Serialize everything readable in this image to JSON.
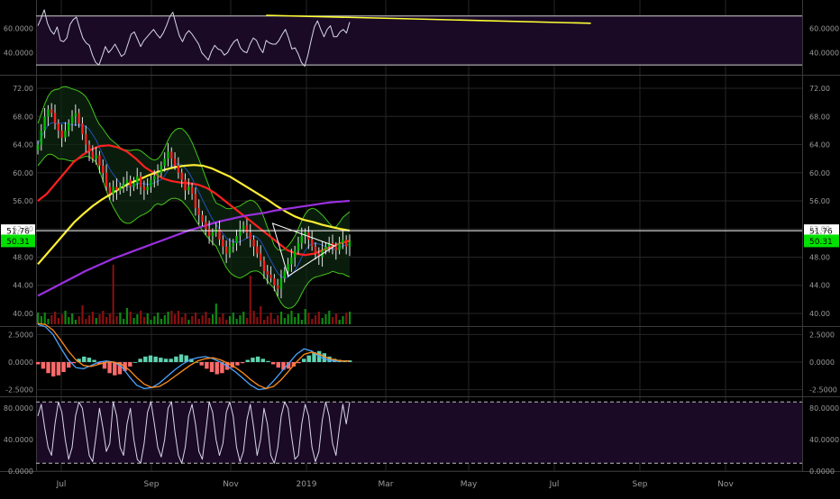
{
  "chart_data": [
    {
      "type": "line",
      "panel": "rsi",
      "y_ticks": [
        "60.0000",
        "40.0000"
      ],
      "ylim": [
        22,
        83
      ],
      "levels": [
        70,
        30
      ],
      "background": "#1a0a26",
      "series": [
        {
          "color": "#d8d8e8",
          "values": [
            62,
            68,
            75,
            64,
            58,
            55,
            61,
            50,
            49,
            52,
            63,
            67,
            69,
            60,
            52,
            48,
            46,
            38,
            32,
            30,
            37,
            45,
            40,
            43,
            47,
            42,
            37,
            39,
            47,
            55,
            57,
            51,
            45,
            50,
            53,
            56,
            59,
            55,
            52,
            56,
            62,
            69,
            73,
            63,
            54,
            49,
            55,
            58,
            55,
            51,
            47,
            40,
            37,
            34,
            41,
            46,
            43,
            42,
            38,
            40,
            45,
            49,
            51,
            44,
            41,
            40,
            47,
            52,
            50,
            44,
            40,
            50,
            48,
            47,
            47,
            50,
            55,
            59,
            52,
            43,
            44,
            39,
            32,
            29,
            38,
            50,
            61,
            66,
            59,
            53,
            59,
            62,
            53,
            53,
            57,
            59,
            56,
            65
          ]
        }
      ],
      "trendline": {
        "color": "#ffff33",
        "from": [
          71,
          70.5
        ],
        "to": [
          172,
          64
        ]
      }
    },
    {
      "type": "candlestick",
      "panel": "price",
      "y_ticks": [
        "72.00",
        "68.00",
        "64.00",
        "60.00",
        "56.00",
        "52.00",
        "48.00",
        "44.00",
        "40.00"
      ],
      "ylim": [
        38.2,
        73.8
      ],
      "price_labels": [
        {
          "text": "51.76",
          "value": 51.76,
          "bg": "#ffffff",
          "fg": "#000000"
        },
        {
          "text": "50.31",
          "value": 50.31,
          "bg": "#00e000",
          "fg": "#000000"
        }
      ],
      "close": [
        64,
        66,
        68,
        69,
        68.5,
        67,
        66,
        65,
        66,
        67,
        68,
        68.5,
        67,
        65.5,
        64,
        63,
        62,
        62.5,
        61,
        60,
        58,
        57,
        58,
        57.5,
        58,
        58.5,
        59,
        58,
        58.5,
        59.5,
        58,
        57.5,
        58,
        59,
        59.5,
        60,
        61,
        62,
        63,
        62,
        61,
        60,
        59,
        57.5,
        58,
        57,
        55,
        54,
        53,
        52,
        51,
        51.5,
        52,
        50.5,
        49.5,
        48.5,
        49.5,
        50,
        51,
        52,
        52.5,
        51.5,
        50.5,
        49.5,
        48.5,
        47.5,
        46,
        45.5,
        45,
        44,
        43.5,
        45,
        46,
        47,
        48,
        49,
        50,
        51,
        51.5,
        50.5,
        49.5,
        48.5,
        48,
        49,
        49.5,
        50,
        49.5,
        49,
        50,
        50.5,
        49.5,
        50.31
      ],
      "series": [
        {
          "name": "",
          "color": "#ff2020",
          "values": [
            56,
            57,
            58.5,
            60,
            61.5,
            62.5,
            63.3,
            63.8,
            63.9,
            63.6,
            63,
            62,
            60.8,
            60,
            59.2,
            58.8,
            58.6,
            58.5,
            58.3,
            57.8,
            57,
            56,
            55,
            54,
            53,
            52,
            51,
            50,
            49,
            48.5,
            48.3,
            48.5,
            49,
            49.5,
            50,
            50.31
          ]
        },
        {
          "name": "",
          "color": "#ffee33",
          "values": [
            47,
            48.5,
            50,
            51.5,
            53,
            54.2,
            55.3,
            56.2,
            57,
            57.8,
            58.5,
            59,
            59.6,
            60.1,
            60.5,
            60.8,
            61,
            61.1,
            61,
            60.6,
            60,
            59.4,
            58.6,
            57.8,
            57,
            56.2,
            55.3,
            54.5,
            53.8,
            53.3,
            53,
            52.6,
            52.3,
            52,
            51.76
          ]
        },
        {
          "name": "",
          "color": "#9b30e0",
          "values": [
            42.5,
            43.2,
            43.9,
            44.6,
            45.3,
            46,
            46.6,
            47.2,
            47.8,
            48.3,
            48.8,
            49.3,
            49.8,
            50.3,
            50.8,
            51.3,
            51.8,
            52.2,
            52.6,
            53,
            53.3,
            53.6,
            53.9,
            54.1,
            54.3,
            54.6,
            54.8,
            55,
            55.2,
            55.4,
            55.6,
            55.8,
            55.9,
            56
          ]
        }
      ],
      "triangle": {
        "color": "#ffffff",
        "points": [
          [
            136,
            52.8
          ],
          [
            172,
            49.6
          ],
          [
            145,
            45.3
          ]
        ]
      }
    },
    {
      "type": "bar",
      "panel": "macd",
      "y_ticks": [
        "2.5000",
        "0.0000",
        "-2.5000"
      ],
      "ylim": [
        -3.1,
        3.1
      ],
      "histogram": [
        -0.2,
        -0.6,
        -1,
        -1.3,
        -1.2,
        -0.9,
        -0.5,
        -0.1,
        0.3,
        0.5,
        0.4,
        0.2,
        -0.2,
        -0.6,
        -1,
        -1.2,
        -1.1,
        -0.8,
        -0.4,
        0,
        0.3,
        0.5,
        0.6,
        0.5,
        0.4,
        0.3,
        0.3,
        0.5,
        0.7,
        0.6,
        0.3,
        0,
        -0.3,
        -0.6,
        -0.9,
        -1.1,
        -1,
        -0.7,
        -0.5,
        -0.3,
        -0.1,
        0.2,
        0.4,
        0.5,
        0.3,
        0.1,
        -0.2,
        -0.5,
        -0.7,
        -0.6,
        -0.4,
        -0.1,
        0.3,
        0.6,
        0.9,
        1,
        0.8,
        0.5,
        0.3,
        0.2,
        0.1,
        0.15
      ],
      "series": [
        {
          "name": "",
          "color": "#4aa3ff",
          "values": [
            3.4,
            3.2,
            2.5,
            1.3,
            0.2,
            -0.5,
            -0.6,
            -0.3,
            0,
            0.1,
            0,
            -0.4,
            -1.3,
            -2.1,
            -2.4,
            -2.3,
            -1.9,
            -1.3,
            -0.7,
            -0.2,
            0.2,
            0.4,
            0.5,
            0.3,
            0,
            -0.4,
            -0.9,
            -1.5,
            -2.1,
            -2.5,
            -2.4,
            -1.7,
            -0.9,
            -0.1,
            0.7,
            1.2,
            1,
            0.5,
            0.2,
            0.1,
            0.1,
            0.1
          ]
        },
        {
          "name": "",
          "color": "#ff8c1a",
          "values": [
            3.5,
            3.4,
            2.9,
            2,
            1,
            0.2,
            -0.3,
            -0.4,
            -0.2,
            0,
            0,
            -0.2,
            -0.7,
            -1.4,
            -2,
            -2.3,
            -2.2,
            -1.8,
            -1.3,
            -0.8,
            -0.3,
            0.1,
            0.3,
            0.4,
            0.2,
            -0.1,
            -0.5,
            -1,
            -1.6,
            -2.1,
            -2.4,
            -2.2,
            -1.6,
            -0.8,
            0,
            0.7,
            0.9,
            0.7,
            0.4,
            0.2,
            0.1,
            0.1
          ]
        }
      ]
    },
    {
      "type": "line",
      "panel": "stoch",
      "y_ticks": [
        "80.0000",
        "40.0000",
        "0.0000"
      ],
      "ylim": [
        0,
        94
      ],
      "levels": [
        88,
        10
      ],
      "background": "#1a0a26",
      "series": [
        {
          "color": "#d8d8e8",
          "values": [
            70,
            85,
            55,
            30,
            20,
            60,
            88,
            75,
            40,
            15,
            30,
            70,
            88,
            80,
            50,
            20,
            12,
            45,
            80,
            55,
            25,
            35,
            88,
            70,
            30,
            20,
            60,
            80,
            40,
            15,
            10,
            35,
            75,
            88,
            60,
            30,
            18,
            40,
            80,
            88,
            50,
            20,
            10,
            30,
            70,
            85,
            60,
            25,
            15,
            50,
            88,
            75,
            40,
            20,
            35,
            75,
            88,
            70,
            30,
            12,
            25,
            65,
            85,
            55,
            20,
            40,
            80,
            60,
            20,
            10,
            30,
            70,
            88,
            80,
            45,
            15,
            20,
            60,
            85,
            70,
            30,
            12,
            25,
            65,
            88,
            70,
            35,
            20,
            55,
            85,
            60,
            88
          ]
        }
      ]
    }
  ],
  "x_labels": [
    "Jul",
    "Sep",
    "Nov",
    "2019",
    "Mar",
    "May",
    "Jul",
    "Sep",
    "Nov"
  ],
  "colors": {
    "up": "#00c000",
    "down": "#ff2020",
    "vol_up": "#0e8a10",
    "vol_down": "#8a1010",
    "grid": "#262626",
    "separator": "#3a3a3a",
    "bb": "#44c41a",
    "hist_pos": "#5fd3b0",
    "hist_neg": "#ff6a6a"
  }
}
